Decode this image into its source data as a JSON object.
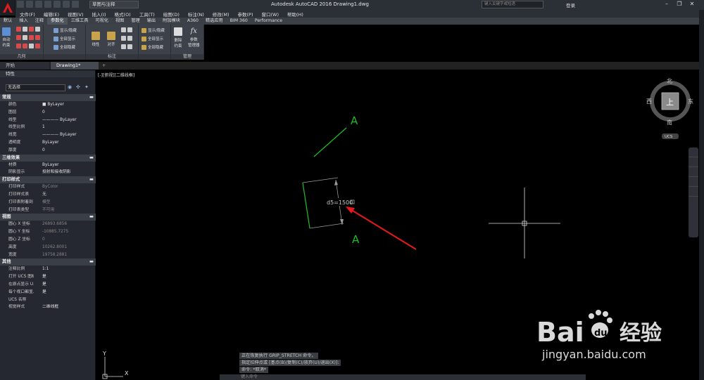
{
  "titlebar": {
    "workspace": "草图与注释",
    "title": "Autodesk AutoCAD 2016    Drawing1.dwg",
    "search_placeholder": "键入关键字或短语",
    "login": "登录"
  },
  "menu": [
    "文件(F)",
    "编辑(E)",
    "视图(V)",
    "插入(I)",
    "格式(O)",
    "工具(T)",
    "绘图(D)",
    "标注(N)",
    "修改(M)",
    "参数(P)",
    "窗口(W)",
    "帮助(H)"
  ],
  "ribbon_tabs": [
    "默认",
    "插入",
    "注释",
    "参数化",
    "三维工具",
    "可视化",
    "视图",
    "管理",
    "输出",
    "附加模块",
    "A360",
    "精选应用",
    "BIM 360",
    "Performance"
  ],
  "ribbon_active_tab": "参数化",
  "ribbon": {
    "auto_constrain": "自动\n约束",
    "show_hide": "显示/隐藏",
    "show_all": "全部显示",
    "hide_all": "全部隐藏",
    "linear": "线性",
    "aligned": "对齐",
    "dim_show_hide": "显示/隐藏",
    "dim_show_all": "全部显示",
    "dim_hide_all": "全部隐藏",
    "delete_constraint": "删除\n约束",
    "param_manager": "参数\n管理器",
    "panel_geometric": "几何",
    "panel_dimensional": "标注",
    "panel_manage": "管理"
  },
  "file_tabs": {
    "start": "开始",
    "drawing": "Drawing1*"
  },
  "palette": {
    "title": "特性",
    "selection": "无选择",
    "sections": [
      {
        "name": "常规",
        "rows": [
          [
            "颜色",
            "■ ByLayer"
          ],
          [
            "图层",
            "0"
          ],
          [
            "线型",
            "———— ByLayer"
          ],
          [
            "线型比例",
            "1"
          ],
          [
            "线宽",
            "———— ByLayer"
          ],
          [
            "透明度",
            "ByLayer"
          ],
          [
            "厚度",
            "0"
          ]
        ]
      },
      {
        "name": "三维效果",
        "rows": [
          [
            "材质",
            "ByLayer"
          ],
          [
            "阴影显示",
            "投射和接收阴影"
          ]
        ]
      },
      {
        "name": "打印样式",
        "rows": [
          [
            "打印样式",
            "ByColor"
          ],
          [
            "打印样式表",
            "无"
          ],
          [
            "打印表附着到",
            "模型"
          ],
          [
            "打印表类型",
            "不可用"
          ]
        ]
      },
      {
        "name": "视图",
        "rows": [
          [
            "圆心 X 坐标",
            "26893.6856"
          ],
          [
            "圆心 Y 坐标",
            "-10885.7275"
          ],
          [
            "圆心 Z 坐标",
            "0"
          ],
          [
            "高度",
            "10262.8001"
          ],
          [
            "宽度",
            "19758.2881"
          ]
        ]
      },
      {
        "name": "其他",
        "rows": [
          [
            "注释比例",
            "1:1"
          ],
          [
            "打开 UCS 图标",
            "是"
          ],
          [
            "在原点显示 U...",
            "是"
          ],
          [
            "每个视口都显...",
            "是"
          ],
          [
            "UCS 名称",
            ""
          ],
          [
            "视觉样式",
            "二维线框"
          ]
        ]
      }
    ]
  },
  "canvas": {
    "view_label": "[-][俯视][二维线框]",
    "dimension_text": "d5=1500",
    "constraint_mark": "A",
    "viewcube": {
      "top": "上",
      "north": "北",
      "south": "南",
      "east": "东",
      "west": "西",
      "ucs": "UCS"
    },
    "ucs_y": "Y",
    "ucs_x": "X"
  },
  "command": {
    "line1": "正在恢复执行 GRIP_STRETCH 命令。",
    "line2": "指定拉伸点或 [基点(B)/复制(C)/放弃(U)/退出(X)]:",
    "line3": "命令: *取消*",
    "input_placeholder": "键入命令"
  },
  "watermark": {
    "brand": "Bai",
    "brand2": "du",
    "cn": "经验",
    "url": "jingyan.baidu.com"
  },
  "colors": {
    "accent_red": "#e31b1b",
    "green": "#1bbf2a",
    "arrow": "#e8191c"
  }
}
